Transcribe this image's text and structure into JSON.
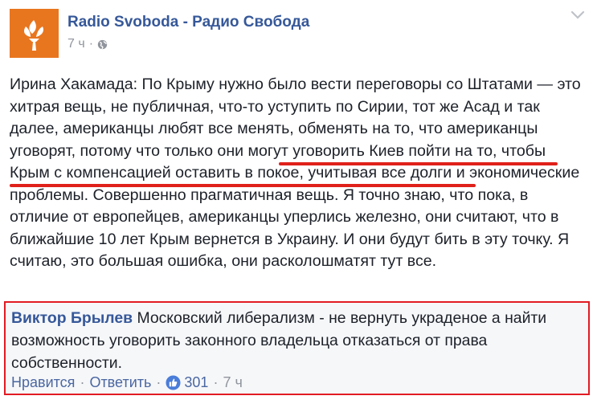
{
  "post": {
    "page_name": "Radio Svoboda - Радио Свобода",
    "time": "7 ч",
    "separator": "·",
    "paragraph_before": "Ирина Хакамада: По Крыму нужно было вести переговоры со Штатами — это хитрая вещь, не публичная, что-то уступить по Сирии, тот же Асад и так далее, американцы любят все менять, обменять на то, что американцы уговорят, потому что ",
    "highlighted_text": "только они могут уговорить Киев пойти на то, чтобы Крым с компенсацией оставить в покое",
    "paragraph_after": ", учитывая все долги и экономические проблемы. Совершенно прагматичная вещь. Я точно знаю, что пока, в отличие от европейцев, американцы уперлись железно, они считают, что в ближайшие 10 лет Крым вернется в Украину. И они будут бить в эту точку. Я считаю, это большая ошибка, они расколошматят тут все.",
    "highlight_color": "#e0201a",
    "icons": [
      "radio-svoboda-logo",
      "globe-icon",
      "chevron-down-icon"
    ]
  },
  "comment": {
    "author": "Виктор Брылев",
    "text": "Московский либерализм - не вернуть украденое а найти возможность уговорить законного владельца отказаться от права собственности.",
    "like_label": "Нравится",
    "reply_label": "Ответить",
    "separator": "·",
    "like_count": "301",
    "time": "7 ч",
    "border_color": "#e21b23",
    "icons": [
      "like-badge-icon"
    ]
  },
  "colors": {
    "brand": "#e8761f",
    "link": "#365899",
    "meta": "#90949c"
  }
}
